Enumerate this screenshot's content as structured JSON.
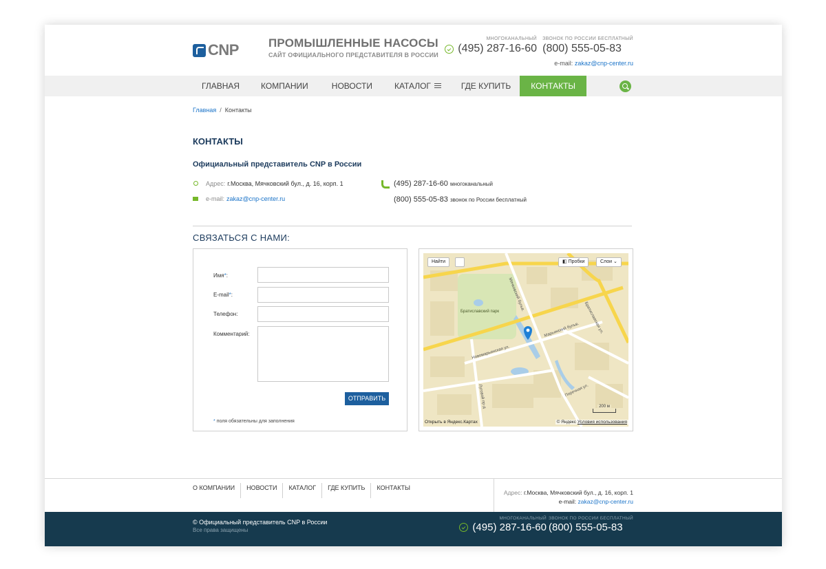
{
  "header": {
    "logo_text": "CNP",
    "title": "ПРОМЫШЛЕННЫЕ НАСОСЫ",
    "subtitle": "САЙТ ОФИЦИАЛЬНОГО ПРЕДСТАВИТЕЛЯ В РОССИИ",
    "phone1_caption": "многоканальный",
    "phone1": "(495) 287-16-60",
    "phone2_caption": "звонок по России бесплатный",
    "phone2": "(800) 555-05-83",
    "email_label": "e-mail:",
    "email": "zakaz@cnp-center.ru"
  },
  "nav": {
    "items": [
      "ГЛАВНАЯ",
      "КОМПАНИИ",
      "НОВОСТИ",
      "КАТАЛОГ",
      "ГДЕ КУПИТЬ",
      "КОНТАКТЫ"
    ],
    "active": "КОНТАКТЫ"
  },
  "breadcrumbs": {
    "home": "Главная",
    "separator": "/",
    "current": "Контакты"
  },
  "page_title": "КОНТАКТЫ",
  "company": {
    "name": "Официальный представитель CNP в России",
    "address_label": "Адрес:",
    "address": "г.Москва, Мячковский бул., д. 16, корп. 1",
    "email_label": "e-mail:",
    "email": "zakaz@cnp-center.ru",
    "phone1": "(495) 287-16-60",
    "phone1_note": "многоканальный",
    "phone2": "(800) 555-05-83",
    "phone2_note": "звонок по России бесплатный"
  },
  "contact_form": {
    "heading": "СВЯЗАТЬСЯ С НАМИ:",
    "name_label": "Имя",
    "email_label": "E-mail",
    "phone_label": "Телефон:",
    "comment_label": "Комментарий:",
    "required_mark": "*",
    "colon": ":",
    "submit": "ОТПРАВИТЬ",
    "required_note": "поля обязательны для заполнения"
  },
  "map": {
    "find_button": "Найти",
    "traffic_button": "Пробки",
    "layers_button": "Слои",
    "park_label": "Братиславский парк",
    "open_link": "Открыть в Яндекс.Картах",
    "copyright": "© Яндекс",
    "terms": "Условия использования",
    "scale": "200 м",
    "streets": [
      "Новомарьинская ул.",
      "Мячковский бульв.",
      "Марьинский бульв.",
      "Братиславская ул.",
      "Луговой пр-д",
      "Поречная ул."
    ]
  },
  "footer": {
    "nav": [
      "О КОМПАНИИ",
      "НОВОСТИ",
      "КАТАЛОГ",
      "ГДЕ КУПИТЬ",
      "КОНТАКТЫ"
    ],
    "address_label": "Адрес:",
    "address": "г.Москва, Мячковский бул., д. 16, корп. 1",
    "email_label": "e-mail:",
    "email": "zakaz@cnp-center.ru",
    "copyright": "© Официальный представитель CNP в России",
    "rights": "Все права защищены",
    "phone1_caption": "многоканальный",
    "phone1": "(495) 287-16-60",
    "phone2_caption": "звонок по России бесплатный",
    "phone2": "(800) 555-05-83"
  },
  "colors": {
    "brand_blue": "#1d5f9e",
    "accent_green": "#6ab446",
    "footer_bg": "#163a4e",
    "title_navy": "#1b3a5c"
  }
}
